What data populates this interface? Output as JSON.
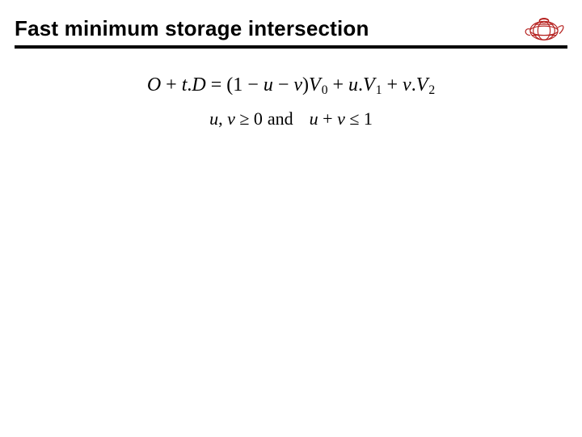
{
  "header": {
    "title": "Fast minimum storage intersection",
    "logo_name": "utah-teapot-logo",
    "logo_color": "#b5201e"
  },
  "equations": {
    "line1": {
      "O": "O",
      "plus1": " + ",
      "t": "t",
      "dot1": ".",
      "D": "D",
      "eq": " = ",
      "lpar": "(1 − ",
      "u1": "u",
      "minus": " − ",
      "v1": "v",
      "rpar": ")",
      "V0": "V",
      "V0sub": "0",
      "plus2": " + ",
      "u2": "u",
      "dot2": ".",
      "V1": "V",
      "V1sub": "1",
      "plus3": " + ",
      "v2": "v",
      "dot3": ".",
      "V2": "V",
      "V2sub": "2"
    },
    "line2": {
      "u": "u",
      "comma": ", ",
      "v": "v",
      "ge": " ≥ 0",
      "and": "and",
      "u2": "u",
      "plus": " + ",
      "v2": "v",
      "le": " ≤ 1"
    }
  }
}
